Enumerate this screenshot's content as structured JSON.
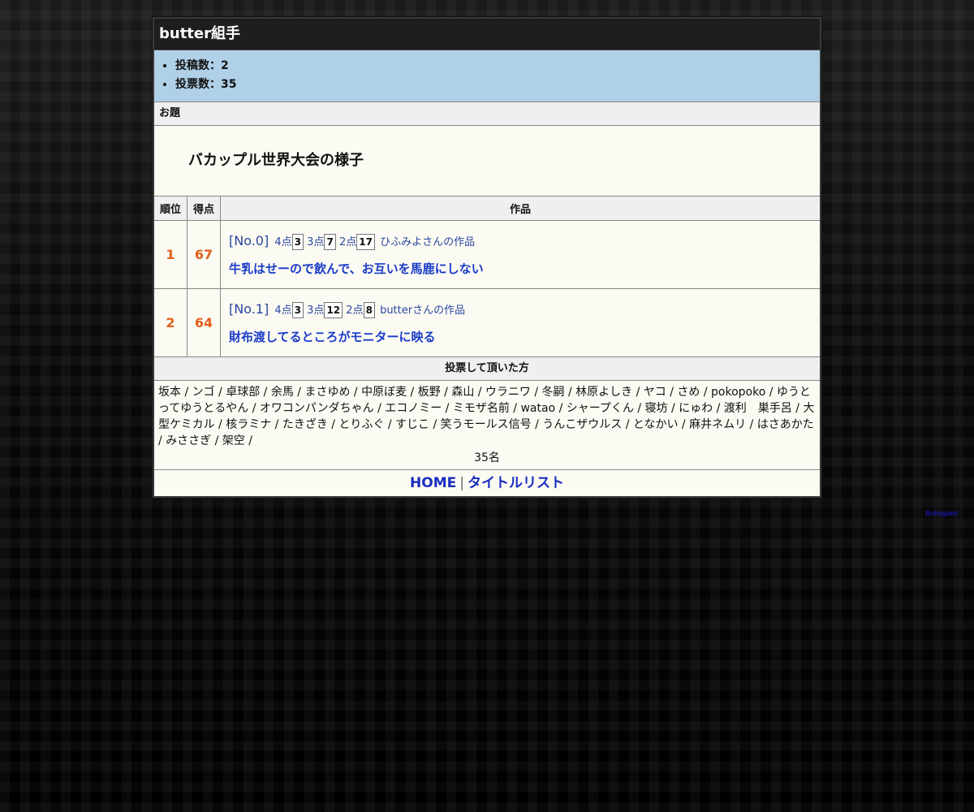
{
  "page_title": "butter組手",
  "stats": [
    "投稿数：2",
    "投票数：35"
  ],
  "topic_header": "お題",
  "topic": "バカップル世界大会の様子",
  "table_headers": {
    "rank": "順位",
    "score": "得点",
    "work": "作品"
  },
  "results": [
    {
      "rank": "1",
      "score": "67",
      "no": "[No.0]",
      "p4_label": "4点",
      "p4": "3",
      "p3_label": "3点",
      "p3": "7",
      "p2_label": "2点",
      "p2": "17",
      "author": "ひふみよさんの作品",
      "title": "牛乳はせーので飲んで、お互いを馬鹿にしない"
    },
    {
      "rank": "2",
      "score": "64",
      "no": "[No.1]",
      "p4_label": "4点",
      "p4": "3",
      "p3_label": "3点",
      "p3": "12",
      "p2_label": "2点",
      "p2": "8",
      "author": "butterさんの作品",
      "title": "財布渡してるところがモニターに映る"
    }
  ],
  "voters_header": "投票して頂いた方",
  "voters": "坂本 / ンゴ / 卓球部 / 余馬 / まさゆめ / 中原ぼ麦 / 板野 / 森山 / ウラニワ / 冬嗣 / 林原よしき / ヤコ / さめ / pokopoko / ゆうとってゆうとるやん / オワコンパンダちゃん / エコノミー / ミモザ名前 / watao / シャープくん / 寝坊 / にゅわ / 渡利　巣手呂 / 大型ケミカル / 核ラミナ / たきざき / とりふぐ / すじこ / 笑うモールス信号 / うんこザウルス / となかい / 麻井ネムリ / はさあかた / みささぎ / 架空 /",
  "voter_count": "35名",
  "footer": {
    "home": "HOME",
    "separator": "|",
    "title_list": "タイトルリスト"
  },
  "credit": "Bokegaen"
}
